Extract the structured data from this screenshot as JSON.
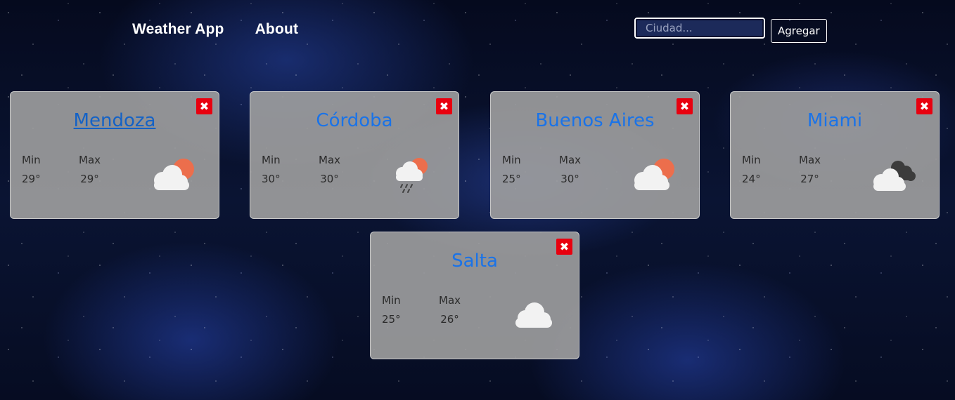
{
  "nav": {
    "brand": "Weather App",
    "about": "About"
  },
  "search": {
    "placeholder": "Ciudad...",
    "button_label": "Agregar"
  },
  "labels": {
    "min": "Min",
    "max": "Max"
  },
  "close_glyph": "✖",
  "cards": [
    {
      "city": "Mendoza",
      "min": "29°",
      "max": "29°",
      "icon": "partly-cloudy-icon"
    },
    {
      "city": "Córdoba",
      "min": "30°",
      "max": "30°",
      "icon": "rain-sun-icon"
    },
    {
      "city": "Buenos Aires",
      "min": "25°",
      "max": "30°",
      "icon": "partly-cloudy-icon"
    },
    {
      "city": "Miami",
      "min": "24°",
      "max": "27°",
      "icon": "dark-clouds-icon"
    },
    {
      "city": "Salta",
      "min": "25°",
      "max": "26°",
      "icon": "cloud-icon"
    }
  ],
  "colors": {
    "city_title": "#1a73e8",
    "close_button": "#e8000f",
    "sun": "#ec6e4c",
    "cloud": "#f2f2f2",
    "dark_cloud": "#3c3c3c"
  }
}
